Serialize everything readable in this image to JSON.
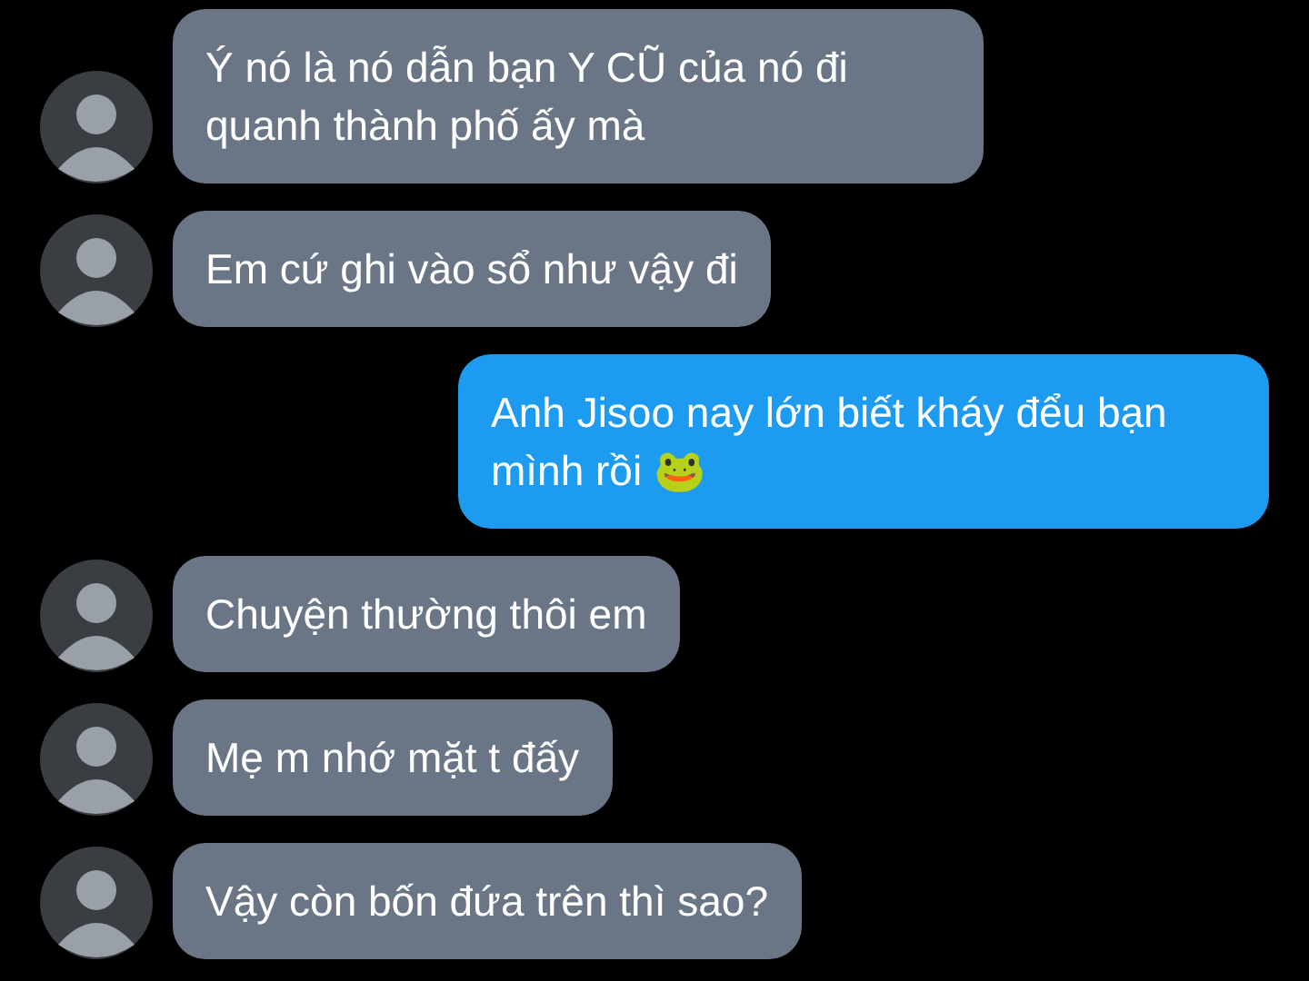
{
  "messages": [
    {
      "kind": "incoming",
      "text": "Ý nó là nó dẫn bạn Y CŨ của nó đi quanh thành phố ấy mà"
    },
    {
      "kind": "incoming",
      "text": "Em cứ ghi vào sổ như vậy đi"
    },
    {
      "kind": "outgoing",
      "text": "Anh Jisoo nay lớn biết kháy đểu bạn mình rồi 🐸"
    },
    {
      "kind": "incoming",
      "text": "Chuyện thường thôi em"
    },
    {
      "kind": "incoming",
      "text": "Mẹ m nhớ mặt t đấy"
    },
    {
      "kind": "incoming",
      "text": "Vậy còn bốn đứa trên thì sao?"
    }
  ]
}
